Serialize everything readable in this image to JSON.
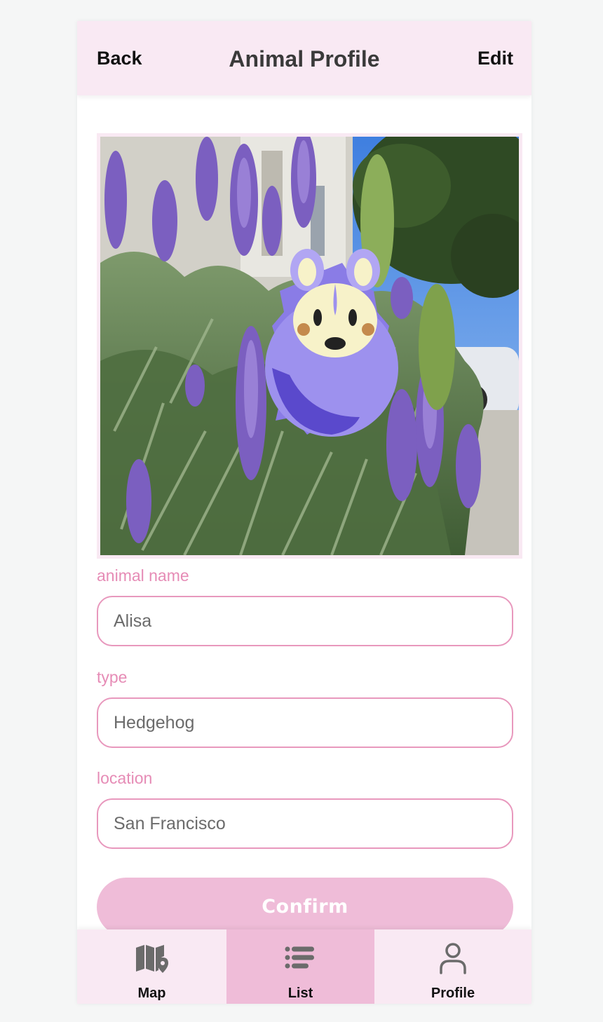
{
  "header": {
    "back_label": "Back",
    "title": "Animal Profile",
    "edit_label": "Edit"
  },
  "form": {
    "name_label": "animal name",
    "name_value": "Alisa",
    "type_label": "type",
    "type_value": "Hedgehog",
    "location_label": "location",
    "location_value": "San Francisco",
    "confirm_label": "Confirm"
  },
  "tabs": [
    {
      "label": "Map",
      "icon": "map-icon",
      "active": false
    },
    {
      "label": "List",
      "icon": "list-icon",
      "active": true
    },
    {
      "label": "Profile",
      "icon": "profile-icon",
      "active": false
    }
  ],
  "colors": {
    "header_bg": "#f9e9f3",
    "accent_pink": "#e898bd",
    "button_pink": "#efbcd8",
    "label_pink": "#e68cb6"
  }
}
